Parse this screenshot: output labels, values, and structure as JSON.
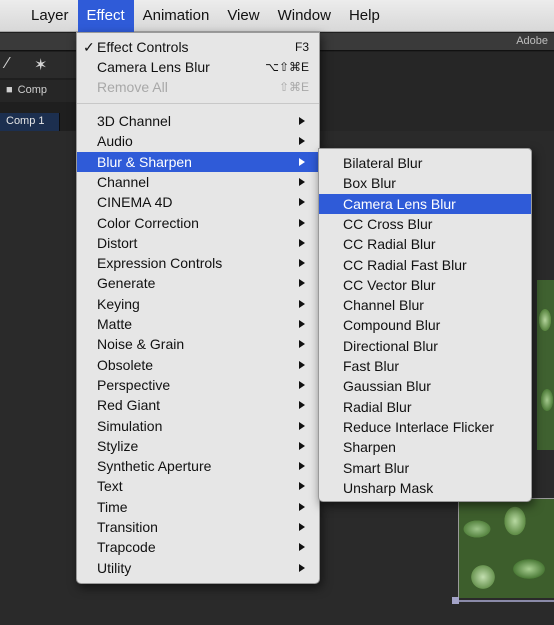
{
  "menubar": {
    "items": [
      "Layer",
      "Effect",
      "Animation",
      "View",
      "Window",
      "Help"
    ],
    "active_index": 1
  },
  "app": {
    "adobe_label": "Adobe",
    "comp_bar_label": "Comp",
    "comp_tab_label": "Comp 1"
  },
  "effect_menu": {
    "top_items": [
      {
        "label": "Effect Controls",
        "shortcut": "F3",
        "checked": true,
        "check_mark": "✓"
      },
      {
        "label": "Camera Lens Blur",
        "shortcut": "⌥⇧⌘E"
      },
      {
        "label": "Remove All",
        "shortcut": "⇧⌘E",
        "disabled": true
      }
    ],
    "categories": [
      "3D Channel",
      "Audio",
      "Blur & Sharpen",
      "Channel",
      "CINEMA 4D",
      "Color Correction",
      "Distort",
      "Expression Controls",
      "Generate",
      "Keying",
      "Matte",
      "Noise & Grain",
      "Obsolete",
      "Perspective",
      "Red Giant",
      "Simulation",
      "Stylize",
      "Synthetic Aperture",
      "Text",
      "Time",
      "Transition",
      "Trapcode",
      "Utility"
    ],
    "highlighted_category": "Blur & Sharpen"
  },
  "submenu": {
    "items": [
      "Bilateral Blur",
      "Box Blur",
      "Camera Lens Blur",
      "CC Cross Blur",
      "CC Radial Blur",
      "CC Radial Fast Blur",
      "CC Vector Blur",
      "Channel Blur",
      "Compound Blur",
      "Directional Blur",
      "Fast Blur",
      "Gaussian Blur",
      "Radial Blur",
      "Reduce Interlace Flicker",
      "Sharpen",
      "Smart Blur",
      "Unsharp Mask"
    ],
    "highlighted_item": "Camera Lens Blur"
  },
  "colors": {
    "highlight": "#2f5bd8",
    "menu_bg": "#e6e6e6"
  }
}
